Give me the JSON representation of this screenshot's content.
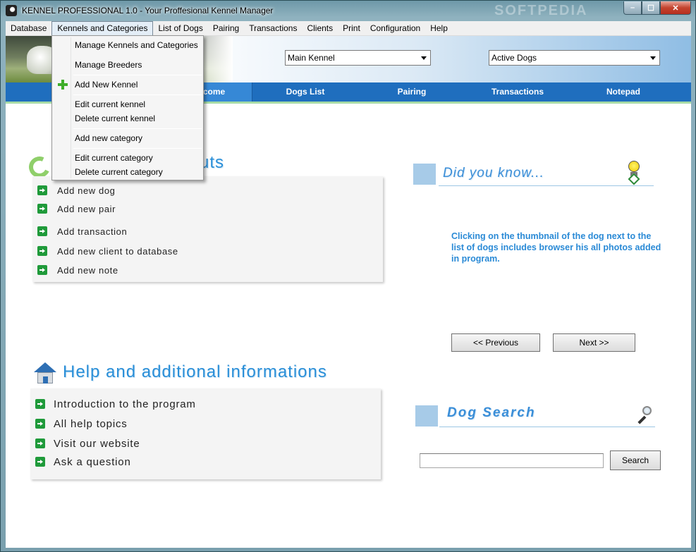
{
  "window": {
    "title": "KENNEL PROFESSIONAL 1.0 - Your Proffesional Kennel Manager",
    "watermark": "SOFTPEDIA",
    "minimize_label": "–",
    "maximize_label": "☐",
    "close_label": "✕"
  },
  "menubar": {
    "items": [
      {
        "label": "Database"
      },
      {
        "label": "Kennels and Categories"
      },
      {
        "label": "List of Dogs"
      },
      {
        "label": "Pairing"
      },
      {
        "label": "Transactions"
      },
      {
        "label": "Clients"
      },
      {
        "label": "Print"
      },
      {
        "label": "Configuration"
      },
      {
        "label": "Help"
      }
    ]
  },
  "dropdown": {
    "items": [
      {
        "label": "Manage Kennels and Categories"
      },
      {
        "label": "Manage Breeders"
      },
      {
        "label": "Add New Kennel",
        "icon": "plus-icon"
      },
      {
        "label": "Edit current kennel"
      },
      {
        "label": "Delete current kennel"
      },
      {
        "label": "Add new category"
      },
      {
        "label": "Edit current category"
      },
      {
        "label": "Delete current category"
      }
    ]
  },
  "header": {
    "kennel_select": "Main Kennel",
    "dogs_select": "Active Dogs"
  },
  "nav": {
    "tabs": [
      {
        "label": "Welcome",
        "active": true
      },
      {
        "label": "Dogs List"
      },
      {
        "label": "Pairing"
      },
      {
        "label": "Transactions"
      },
      {
        "label": "Notepad"
      }
    ]
  },
  "shortcuts": {
    "title_visible": "cuts",
    "items": [
      {
        "label": "Add new dog"
      },
      {
        "label": "Add new pair"
      },
      {
        "label": "Add transaction"
      },
      {
        "label": "Add new client to database"
      },
      {
        "label": "Add new note"
      }
    ]
  },
  "help": {
    "title": "Help and additional informations",
    "items": [
      {
        "label": "Introduction to the program"
      },
      {
        "label": "All help topics"
      },
      {
        "label": "Visit our website"
      },
      {
        "label": "Ask a question"
      }
    ]
  },
  "did_you_know": {
    "title": "Did you know...",
    "text": "Clicking on the thumbnail of the dog next to the list of dogs includes browser his all photos added in program.",
    "prev_label": "<< Previous",
    "next_label": "Next >>"
  },
  "dog_search": {
    "title": "Dog Search",
    "input_value": "",
    "button_label": "Search"
  },
  "colors": {
    "nav_blue": "#1f6ebe",
    "title_blue": "#2a8fd8",
    "shortcut_green": "#1f9a3a"
  }
}
